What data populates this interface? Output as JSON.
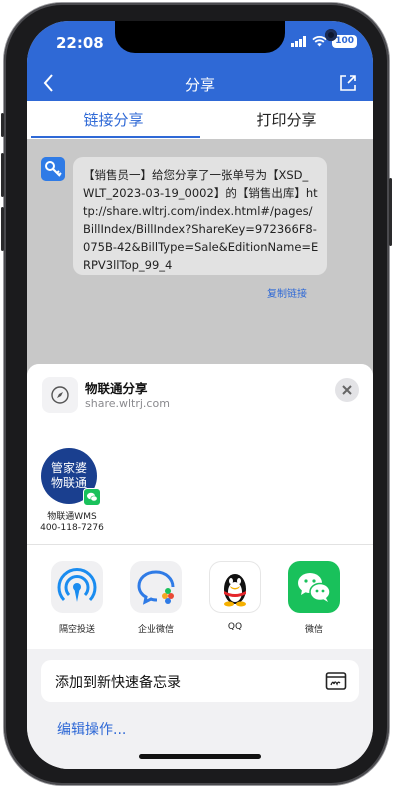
{
  "status_bar": {
    "time": "22:08",
    "battery": "100"
  },
  "nav": {
    "title": "分享"
  },
  "tabs": {
    "link_share": "链接分享",
    "print_share": "打印分享"
  },
  "message": {
    "text": "【销售员一】给您分享了一张单号为【XSD_WLT_2023-03-19_0002】的【销售出库】http://share.wltrj.com/index.html#/pages/BillIndex/BillIndex?ShareKey=972366F8-075B-42&BillType=Sale&EditionName=ERPV3llTop_99_4",
    "copy_link": "复制链接"
  },
  "share_sheet": {
    "title": "物联通分享",
    "url": "share.wltrj.com",
    "contact": {
      "avatar_line1": "管家婆",
      "avatar_line2": "物联通",
      "name_line1": "物联通WMS",
      "name_line2": "400-118-7276"
    },
    "apps": [
      {
        "label": "隔空投送",
        "icon": "airdrop-icon"
      },
      {
        "label": "企业微信",
        "icon": "wecom-icon"
      },
      {
        "label": "QQ",
        "icon": "qq-icon"
      },
      {
        "label": "微信",
        "icon": "wechat-icon"
      }
    ],
    "action": {
      "label": "添加到新快速备忘录",
      "icon": "quick-note-icon"
    },
    "edit_actions": "编辑操作..."
  },
  "colors": {
    "brand_blue": "#2f69d6",
    "wechat_green": "#19c15b"
  }
}
